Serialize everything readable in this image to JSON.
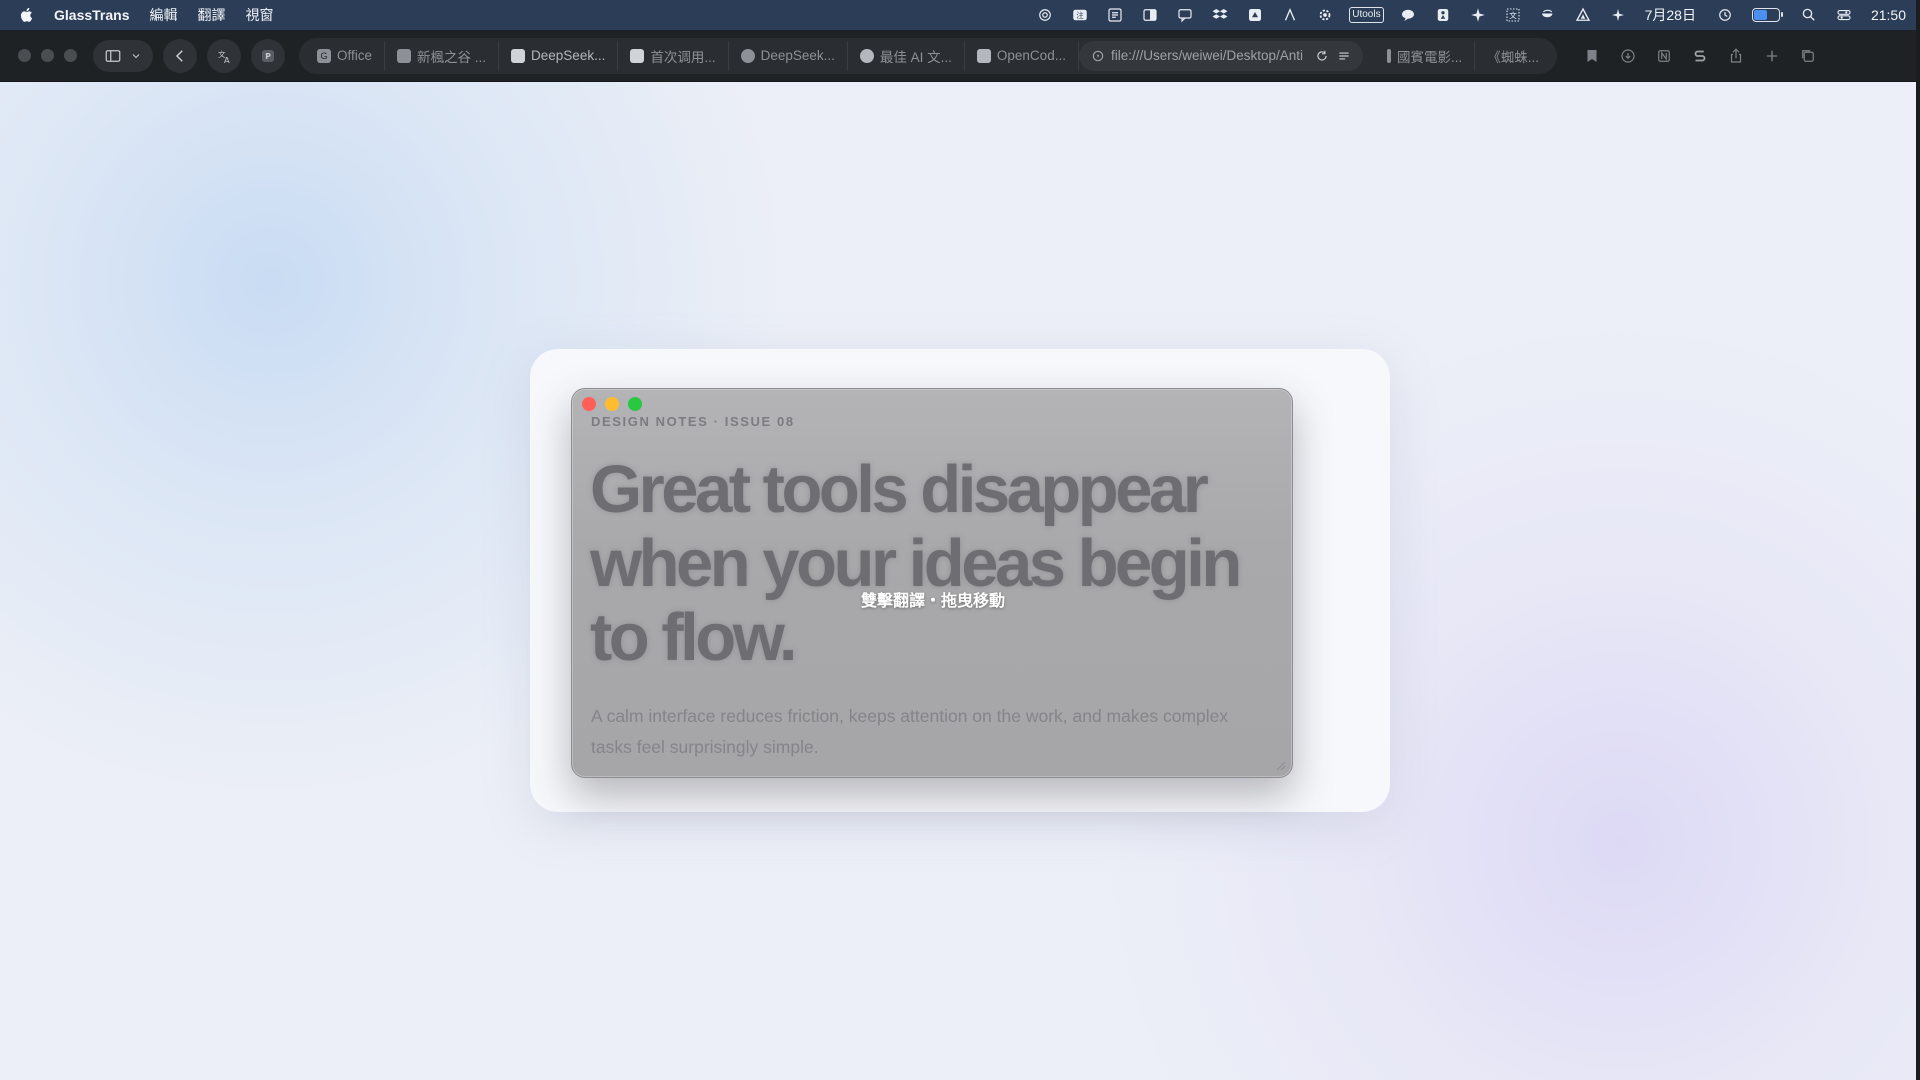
{
  "menubar": {
    "app_name": "GlassTrans",
    "menus": [
      "編輯",
      "翻譯",
      "視窗"
    ],
    "status_box_label": "Utools",
    "date": "7月28日",
    "time": "21:50",
    "battery_level": 0.6
  },
  "toolbar": {
    "tabs": [
      {
        "label": "Office",
        "favicon": "G"
      },
      {
        "label": "新楓之谷 ...",
        "favicon": "doc"
      },
      {
        "label": "DeepSeek...",
        "favicon": "bird"
      },
      {
        "label": "首次调用...",
        "favicon": "bird"
      },
      {
        "label": "DeepSeek...",
        "favicon": "dot"
      },
      {
        "label": "最佳 AI 文...",
        "favicon": "dot"
      },
      {
        "label": "OpenCod...",
        "favicon": "box"
      }
    ],
    "url": "file:///Users/weiwei/Desktop/Anti",
    "tabs_after": [
      {
        "label": "國賓電影..."
      },
      {
        "label": "《蜘蛛..."
      }
    ]
  },
  "glass_window": {
    "eyebrow": "DESIGN NOTES · ISSUE 08",
    "headline": "Great tools disappear when your ideas begin to flow.",
    "body": "A calm interface reduces friction, keeps attention on the work, and makes complex tasks feel surprisingly simple.",
    "hint": "雙擊翻譯・拖曳移動",
    "dot_colors": [
      "#ff5f57",
      "#febc2e",
      "#28c840"
    ]
  },
  "colors": {
    "menubar_bg": "#2c3d57",
    "toolbar_bg": "#1f2225",
    "card_bg": "#f7f8fc"
  },
  "icons": {
    "menubar_left": "apple-logo-icon",
    "status": [
      "openai-icon",
      "translate-icon",
      "text-icon",
      "sidebar-icon",
      "chat-bubble-icon",
      "dropbox-icon",
      "drive-icon",
      "font-icon",
      "settings-gear-icon",
      "utools-icon",
      "message-icon",
      "figure-icon",
      "sparkle-icon",
      "translate-box-icon",
      "coffee-icon",
      "triangle-icon",
      "sparkle2-icon",
      "clock-icon",
      "battery-icon",
      "search-icon",
      "control-center-icon"
    ],
    "toolbar_right": [
      "bookmark-icon",
      "download-icon",
      "notion-icon",
      "s-icon",
      "share-icon",
      "new-tab-icon",
      "tab-overview-icon"
    ]
  }
}
